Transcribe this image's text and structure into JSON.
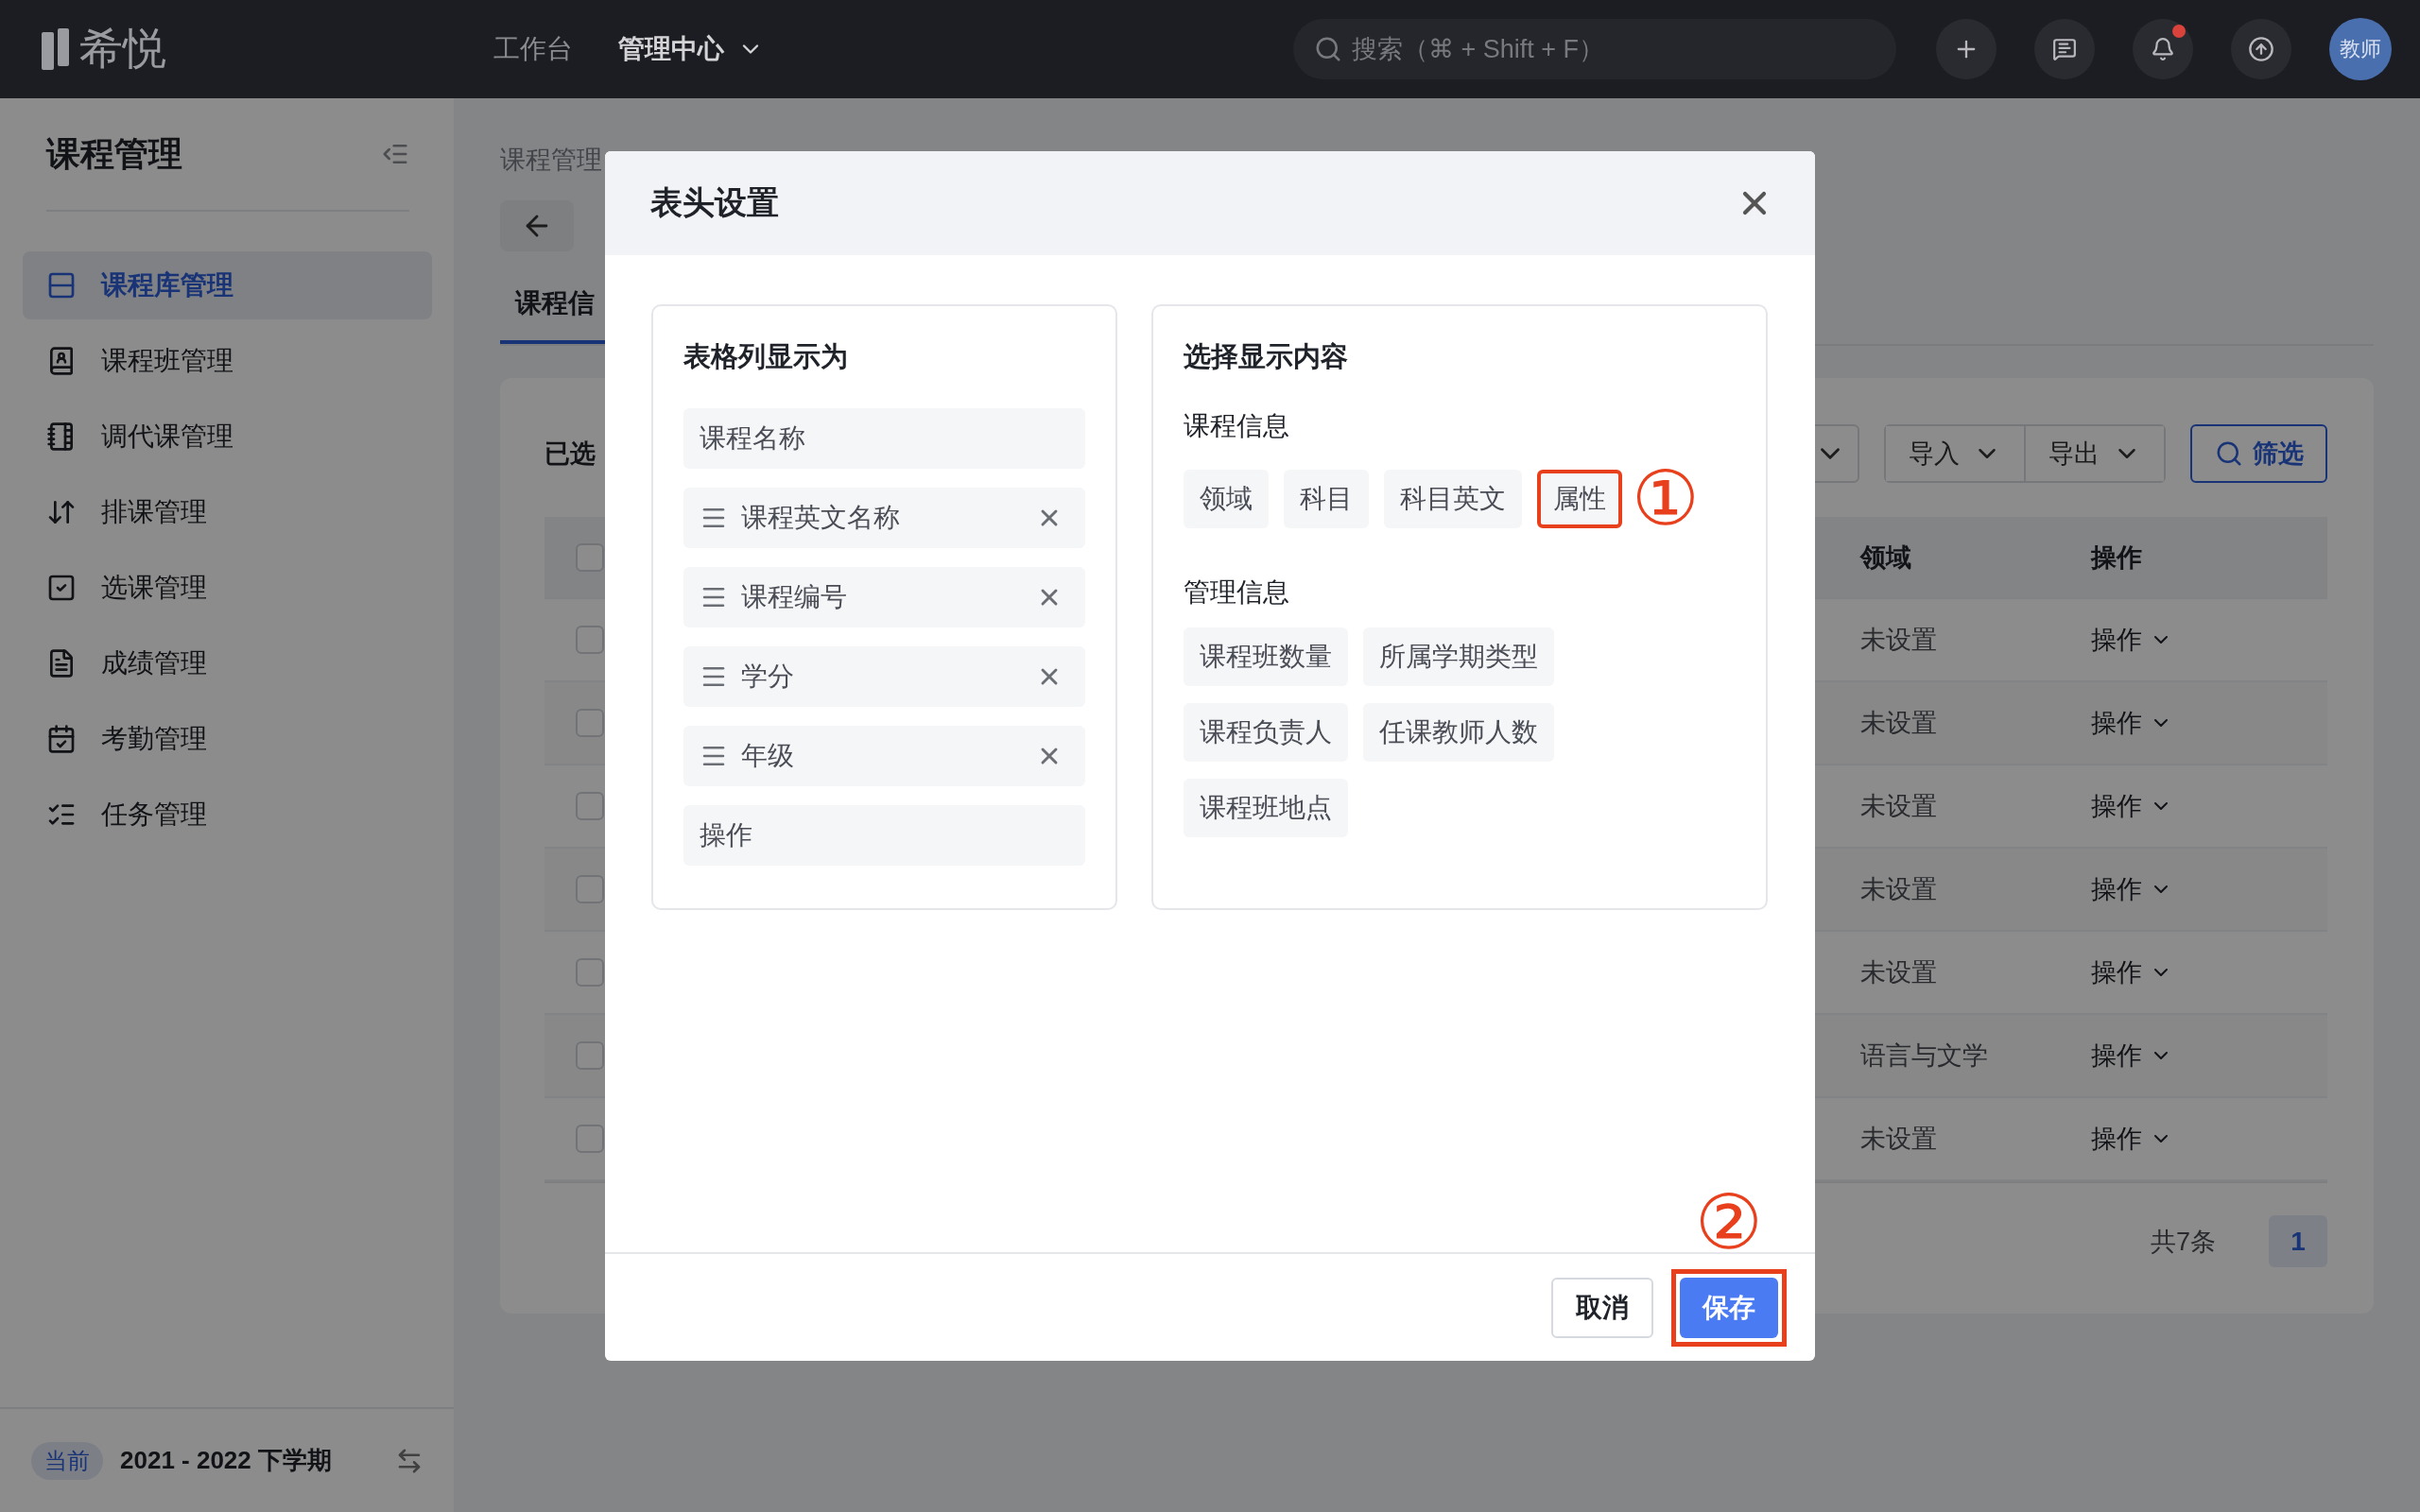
{
  "top_bar": {
    "logo_text": "希悦",
    "nav": [
      {
        "label": "工作台",
        "selected": false,
        "kind": "link"
      },
      {
        "label": "管理中心",
        "selected": true,
        "kind": "dropdown"
      }
    ],
    "search": {
      "placeholder": "搜索（⌘ + Shift + F）"
    },
    "notifications": {
      "unread": true
    },
    "avatar": {
      "label": "教师"
    }
  },
  "sidebar": {
    "title": "课程管理",
    "items": [
      {
        "label": "课程库管理",
        "selected": true
      },
      {
        "label": "课程班管理",
        "selected": false
      },
      {
        "label": "调代课管理",
        "selected": false
      },
      {
        "label": "排课管理",
        "selected": false
      },
      {
        "label": "选课管理",
        "selected": false
      },
      {
        "label": "成绩管理",
        "selected": false
      },
      {
        "label": "考勤管理",
        "selected": false
      },
      {
        "label": "任务管理",
        "selected": false
      }
    ],
    "term": {
      "badge": "当前",
      "label": "2021 - 2022 下学期"
    }
  },
  "breadcrumb": [
    "课程管理"
  ],
  "tabs": [
    {
      "label": "课程信",
      "selected": true
    }
  ],
  "selection_label": "已选",
  "toolbar": {
    "buttons": [
      {
        "label": "导入"
      },
      {
        "label": "导出"
      }
    ],
    "filter": {
      "label": "筛选"
    }
  },
  "table": {
    "columns": [
      "领域",
      "操作"
    ],
    "header_checked": false,
    "rows": [
      {
        "checked": false,
        "cells": [
          "未设置",
          "操作"
        ]
      },
      {
        "checked": false,
        "cells": [
          "未设置",
          "操作"
        ]
      },
      {
        "checked": false,
        "cells": [
          "未设置",
          "操作"
        ]
      },
      {
        "checked": false,
        "cells": [
          "未设置",
          "操作"
        ]
      },
      {
        "checked": false,
        "cells": [
          "未设置",
          "操作"
        ]
      },
      {
        "checked": false,
        "cells": [
          "语言与文学",
          "操作"
        ]
      },
      {
        "checked": false,
        "cells": [
          "未设置",
          "操作"
        ]
      }
    ]
  },
  "pagination": {
    "total": "共7条",
    "pages": [
      {
        "label": "1",
        "selected": true
      }
    ]
  },
  "dialog": {
    "title": "表头设置",
    "columns_panel": {
      "title": "表格列显示为",
      "items": [
        {
          "label": "课程名称",
          "kind": "fixed"
        },
        {
          "label": "课程英文名称",
          "kind": "draggable"
        },
        {
          "label": "课程编号",
          "kind": "draggable"
        },
        {
          "label": "学分",
          "kind": "draggable"
        },
        {
          "label": "年级",
          "kind": "draggable"
        },
        {
          "label": "操作",
          "kind": "fixed"
        }
      ]
    },
    "content_panel": {
      "title": "选择显示内容",
      "sections": [
        {
          "title": "课程信息",
          "annotation": "①",
          "tags": [
            {
              "label": "领域",
              "highlighted": false
            },
            {
              "label": "科目",
              "highlighted": false
            },
            {
              "label": "科目英文",
              "highlighted": false
            },
            {
              "label": "属性",
              "highlighted": true
            }
          ]
        },
        {
          "title": "管理信息",
          "tags": [
            {
              "label": "课程班数量",
              "highlighted": false
            },
            {
              "label": "所属学期类型",
              "highlighted": false
            },
            {
              "label": "课程负责人",
              "highlighted": false
            },
            {
              "label": "任课教师人数",
              "highlighted": false
            },
            {
              "label": "课程班地点",
              "highlighted": false
            }
          ]
        }
      ]
    },
    "buttons": [
      {
        "label": "取消",
        "kind": "secondary",
        "highlighted": false
      },
      {
        "label": "保存",
        "kind": "primary",
        "highlighted": true,
        "annotation": "②"
      }
    ]
  }
}
